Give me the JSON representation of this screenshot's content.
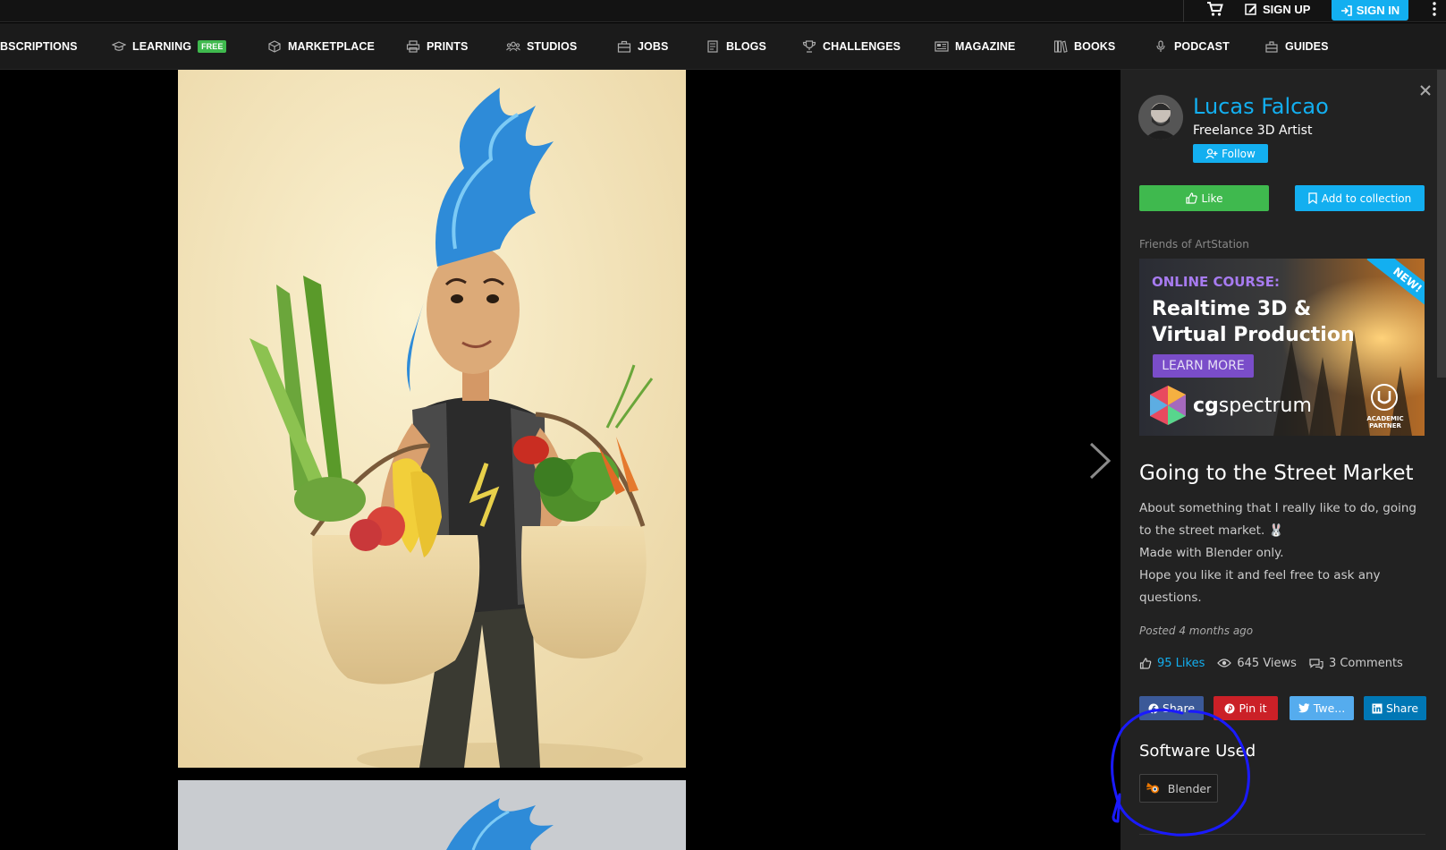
{
  "header": {
    "signup_label": "SIGN UP",
    "signin_label": "SIGN IN"
  },
  "nav": {
    "items": [
      {
        "label": "BSCRIPTIONS"
      },
      {
        "label": "LEARNING",
        "badge": "FREE"
      },
      {
        "label": "MARKETPLACE"
      },
      {
        "label": "PRINTS"
      },
      {
        "label": "STUDIOS"
      },
      {
        "label": "JOBS"
      },
      {
        "label": "BLOGS"
      },
      {
        "label": "CHALLENGES"
      },
      {
        "label": "MAGAZINE"
      },
      {
        "label": "BOOKS"
      },
      {
        "label": "PODCAST"
      },
      {
        "label": "GUIDES"
      }
    ]
  },
  "artist": {
    "name": "Lucas Falcao",
    "role": "Freelance 3D Artist",
    "follow_label": "Follow"
  },
  "actions": {
    "like_label": "Like",
    "collection_label": "Add to collection"
  },
  "sponsor": {
    "heading": "Friends of ArtStation",
    "ad": {
      "kicker": "ONLINE COURSE:",
      "title_line1": "Realtime 3D &",
      "title_line2": "Virtual Production",
      "cta": "LEARN MORE",
      "brand_bold": "cg",
      "brand_rest": "spectrum",
      "ribbon": "NEW!",
      "partner_line1": "ACADEMIC",
      "partner_line2": "PARTNER"
    }
  },
  "artwork": {
    "title": "Going to the Street Market",
    "description": [
      "About something that I really like to do, going to the street market. 🐰",
      "Made with Blender only.",
      "Hope you like it and feel free to ask any questions."
    ],
    "posted": "Posted 4 months ago",
    "likes": "95 Likes",
    "views": "645 Views",
    "comments": "3 Comments"
  },
  "share": {
    "facebook": "Share",
    "pinterest": "Pin it",
    "twitter": "Twe...",
    "linkedin": "Share"
  },
  "software": {
    "heading": "Software Used",
    "items": [
      "Blender"
    ]
  },
  "colors": {
    "accent": "#13aff0",
    "like_green": "#3fb94e",
    "annotation": "#1a1aff"
  }
}
